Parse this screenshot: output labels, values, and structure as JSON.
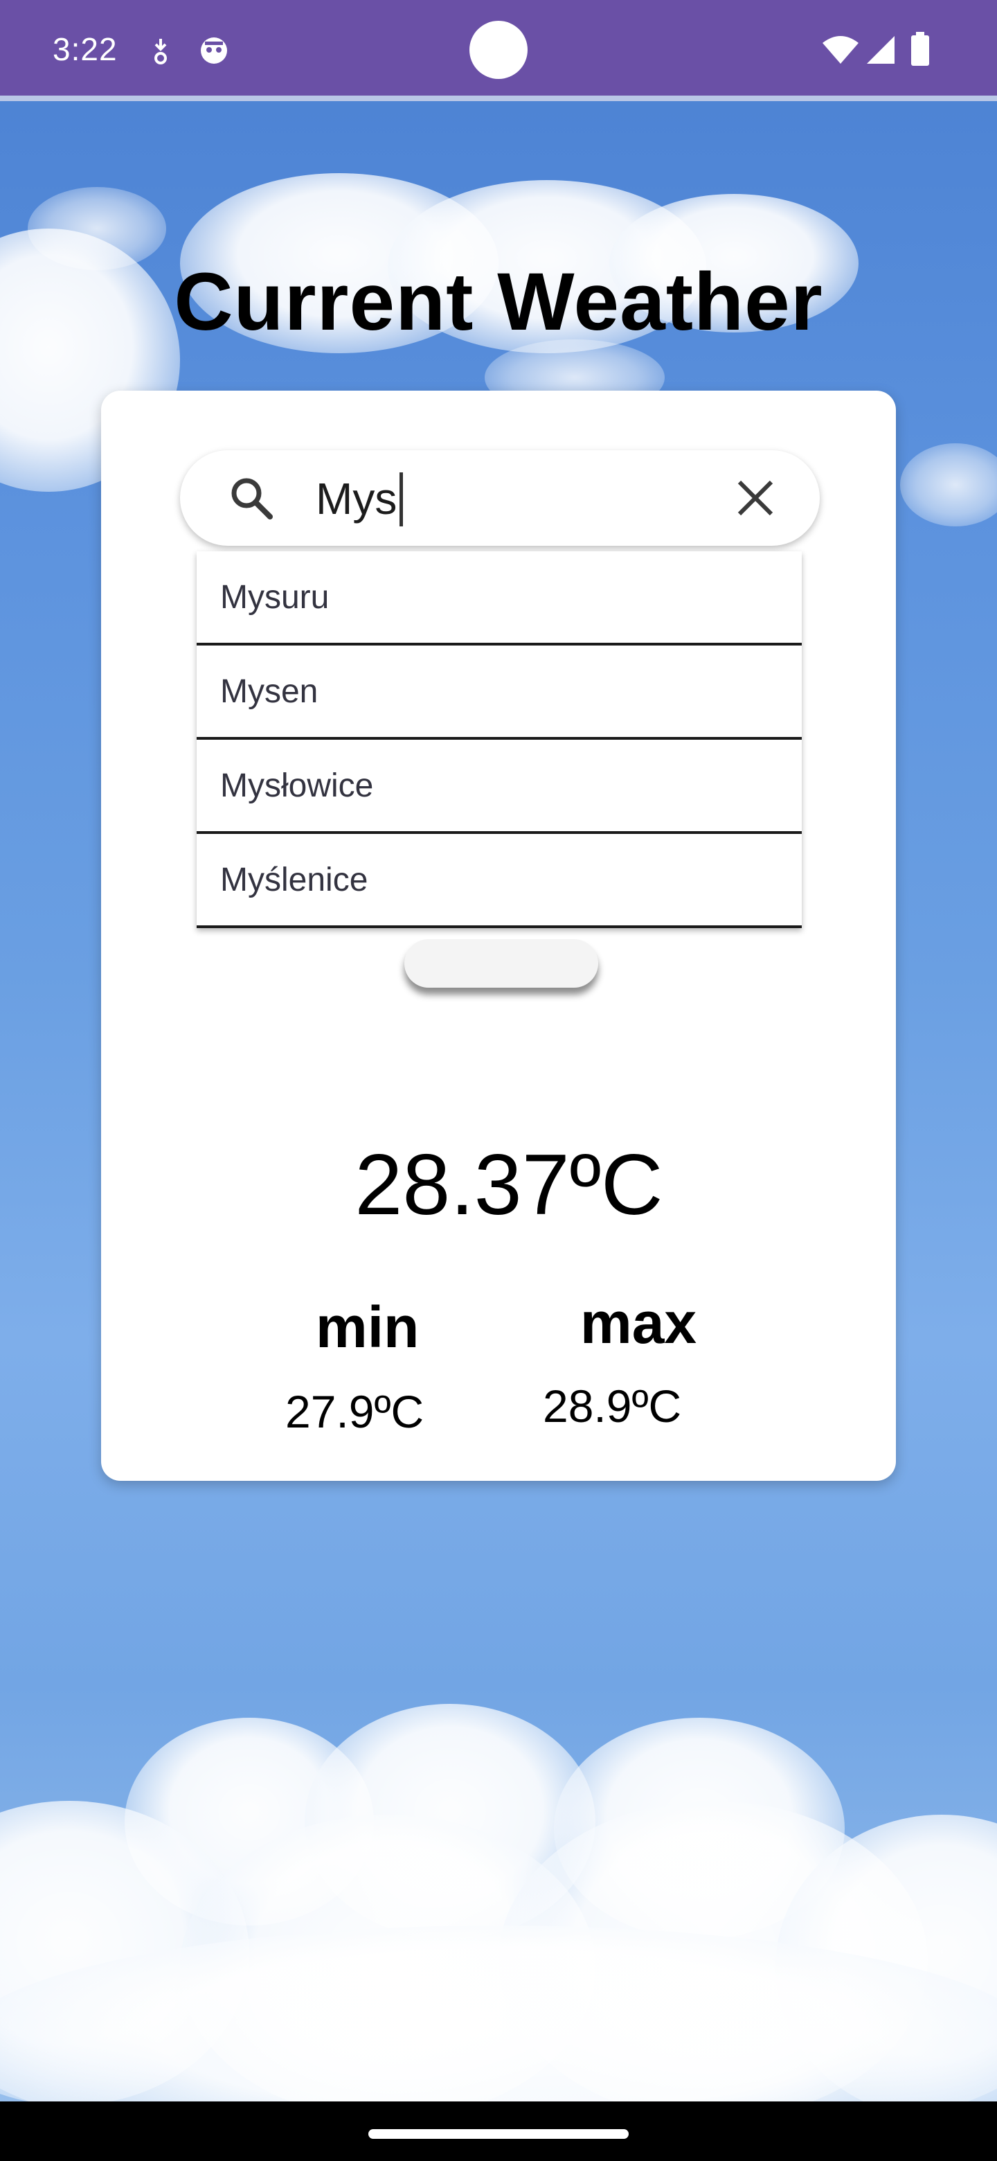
{
  "status_bar": {
    "time": "3:22",
    "icons": [
      "download-icon",
      "notification-icon",
      "wifi-icon",
      "signal-icon",
      "battery-icon"
    ]
  },
  "app": {
    "title": "Current Weather"
  },
  "search": {
    "query": "Mys",
    "icon": "search-icon",
    "clear_icon": "close-icon"
  },
  "suggestions": [
    "Mysuru",
    "Mysen",
    "Mysłowice",
    "Myślenice"
  ],
  "weather": {
    "temperature": "28.37ºC",
    "min_label": "min",
    "min_value": "27.9ºC",
    "max_label": "max",
    "max_value": "28.9ºC"
  },
  "colors": {
    "status_bar": "#6a50a6",
    "sky": "#5f94dc",
    "card": "#ffffff",
    "text": "#000000"
  }
}
